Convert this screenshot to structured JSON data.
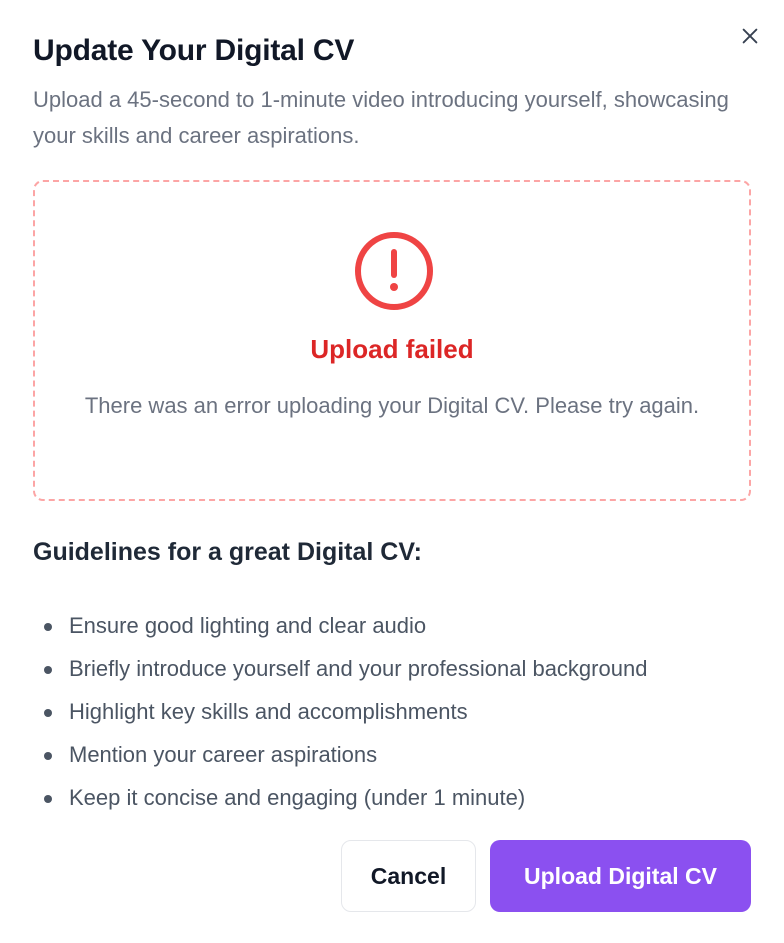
{
  "dialog": {
    "title": "Update Your Digital CV",
    "subtitle": "Upload a 45-second to 1-minute video introducing yourself, showcasing your skills and career aspirations."
  },
  "upload": {
    "status_title": "Upload failed",
    "status_message": "There was an error uploading your Digital CV. Please try again.",
    "icon": "alert-circle-icon",
    "error_color": "#dc2626",
    "border_color": "#fca5a5"
  },
  "guidelines": {
    "title": "Guidelines for a great Digital CV:",
    "items": [
      "Ensure good lighting and clear audio",
      "Briefly introduce yourself and your professional background",
      "Highlight key skills and accomplishments",
      "Mention your career aspirations",
      "Keep it concise and engaging (under 1 minute)"
    ]
  },
  "actions": {
    "cancel_label": "Cancel",
    "upload_label": "Upload Digital CV",
    "accent_color": "#8b50f0"
  }
}
